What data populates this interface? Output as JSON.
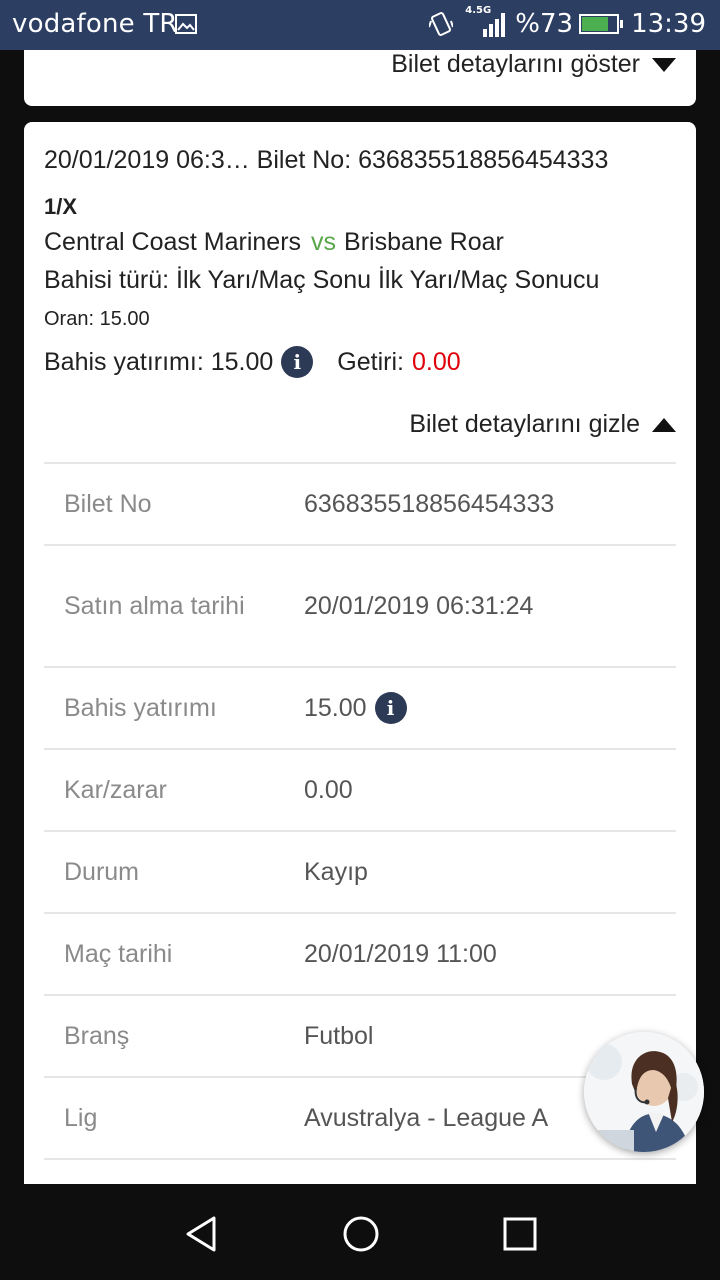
{
  "status_bar": {
    "carrier": "vodafone TR",
    "network": "4.5G",
    "battery": "%73",
    "battery_level": 0.73,
    "time": "13:39"
  },
  "prev_ticket": {
    "toggle_label": "Bilet detaylarını göster"
  },
  "ticket": {
    "header": "20/01/2019 06:3… Bilet No: 636835518856454333",
    "selection": "1/X",
    "home_team": "Central Coast Mariners",
    "vs": "vs",
    "away_team": "Brisbane Roar",
    "bet_type": "Bahisi türü: İlk Yarı/Maç Sonu İlk Yarı/Maç Sonucu",
    "odds": "Oran: 15.00",
    "stake_label": "Bahis yatırımı: 15.00",
    "return_label": "Getiri:",
    "return_value": "0.00",
    "toggle_label": "Bilet detaylarını gizle",
    "details": {
      "ticket_no_label": "Bilet No",
      "ticket_no": "636835518856454333",
      "purchase_date_label": "Satın alma tarihi",
      "purchase_date": "20/01/2019 06:31:24",
      "stake_label": "Bahis yatırımı",
      "stake": "15.00",
      "profit_label": "Kar/zarar",
      "profit": "0.00",
      "status_label": "Durum",
      "status": "Kayıp",
      "match_date_label": "Maç tarihi",
      "match_date": "20/01/2019 11:00",
      "sport_label": "Branş",
      "sport": "Futbol",
      "league_label": "Lig",
      "league": "Avustralya - League A"
    }
  },
  "colors": {
    "status_bar": "#2d3e63",
    "loss_red": "#e0000a",
    "vs_green": "#5aa64b",
    "info_icon": "#2c3a55"
  },
  "icons": {
    "image_notification": "image-icon",
    "vibrate": "vibrate-icon",
    "signal": "signal-icon",
    "battery": "battery-charging-icon",
    "info": "info-icon",
    "support": "support-agent-avatar",
    "back": "back-icon",
    "home": "home-icon",
    "recents": "recents-icon"
  }
}
